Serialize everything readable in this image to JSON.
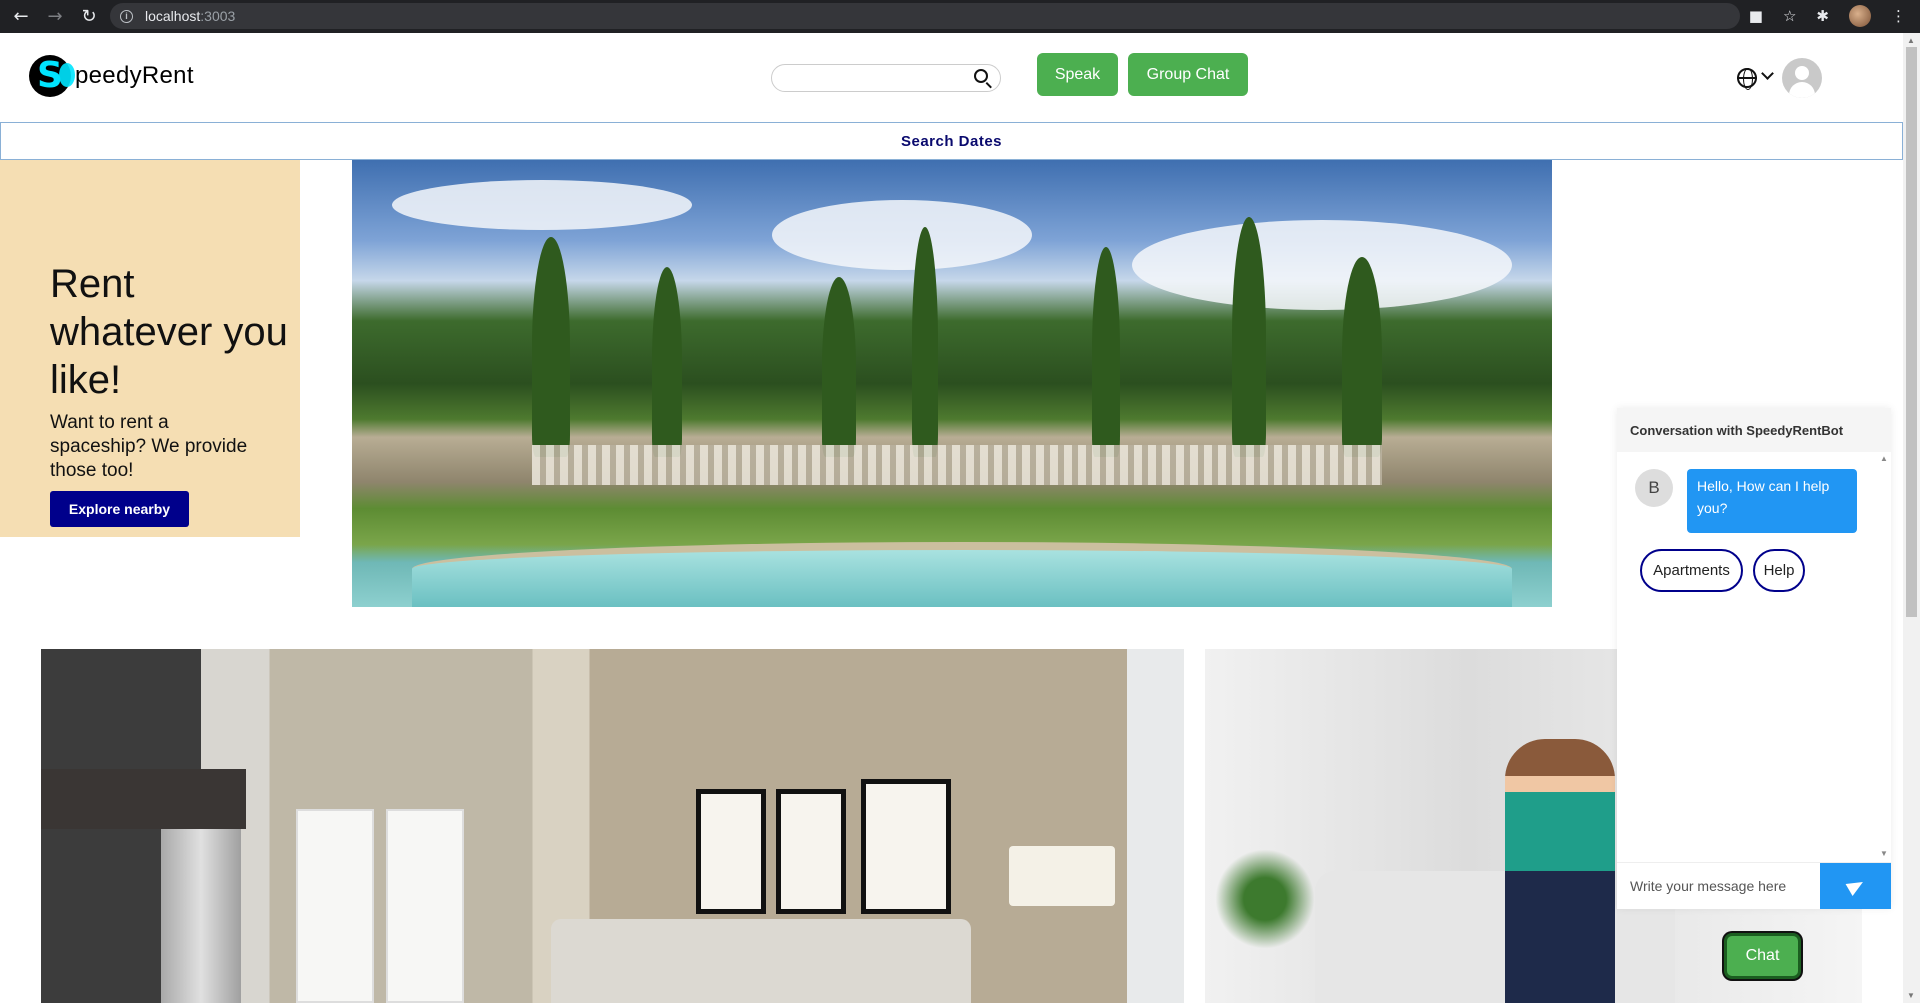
{
  "browser": {
    "url_host": "localhost",
    "url_port": ":3003"
  },
  "header": {
    "logo_letter": "S",
    "logo_text": "peedyRent",
    "search_placeholder": "",
    "speak_label": "Speak",
    "group_chat_label": "Group Chat"
  },
  "search_dates_label": "Search Dates",
  "promo": {
    "title": "Rent whatever you like!",
    "subtitle": "Want to rent a spaceship? We provide those too!",
    "button_label": "Explore nearby"
  },
  "chat": {
    "header": "Conversation with SpeedyRentBot",
    "bot_initial": "B",
    "bot_message": "Hello, How can I help you?",
    "quick_replies": [
      "Apartments",
      "Help"
    ],
    "input_placeholder": "Write your message here",
    "toggle_label": "Chat"
  },
  "colors": {
    "accent_green": "#4caf50",
    "promo_bg": "#f5deb3",
    "navy": "#00008b",
    "chat_blue": "#2196f3"
  },
  "icons": [
    "back-arrow-icon",
    "forward-arrow-icon",
    "reload-icon",
    "info-icon",
    "camera-off-icon",
    "star-icon",
    "extensions-icon",
    "menu-icon",
    "search-icon",
    "globe-icon",
    "chevron-down-icon",
    "user-avatar-icon",
    "send-icon"
  ]
}
